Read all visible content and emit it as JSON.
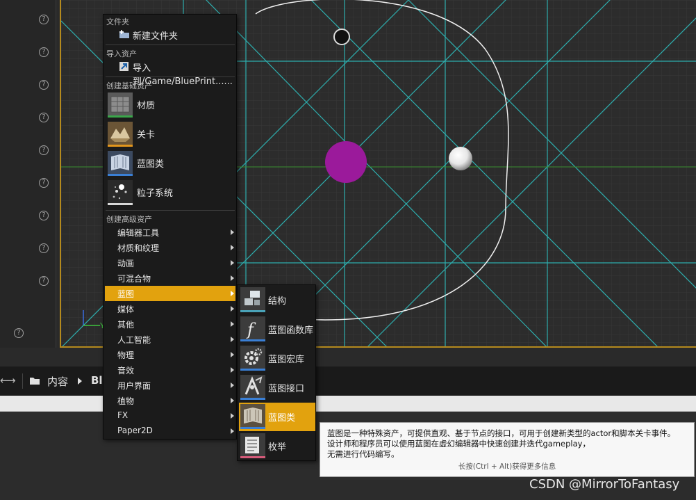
{
  "viewport": {
    "axis_label_y": "Y"
  },
  "help_icon_glyph": "?",
  "content_browser": {
    "back_glyph": "←",
    "forward_glyph": "→",
    "crumb_root": "内容",
    "crumb_next": "Blu"
  },
  "context_menu": {
    "section_folder": "文件夹",
    "new_folder": "新建文件夹",
    "section_import": "导入资产",
    "import_to": "导入到/Game/BluePrint......",
    "section_basic": "创建基础资产",
    "basic_items": [
      {
        "label": "材质",
        "icon": "material-icon",
        "bar_color": "#3aa64a"
      },
      {
        "label": "关卡",
        "icon": "level-icon",
        "bar_color": "#e2961c"
      },
      {
        "label": "蓝图类",
        "icon": "blueprint-class-icon",
        "bar_color": "#3a7fd5"
      },
      {
        "label": "粒子系统",
        "icon": "particle-system-icon",
        "bar_color": "#d8d8d8"
      }
    ],
    "section_advanced": "创建高级资产",
    "advanced_items": [
      {
        "label": "编辑器工具"
      },
      {
        "label": "材质和纹理"
      },
      {
        "label": "动画"
      },
      {
        "label": "可混合物"
      },
      {
        "label": "蓝图"
      },
      {
        "label": "媒体"
      },
      {
        "label": "其他"
      },
      {
        "label": "人工智能"
      },
      {
        "label": "物理"
      },
      {
        "label": "音效"
      },
      {
        "label": "用户界面"
      },
      {
        "label": "植物"
      },
      {
        "label": "FX"
      },
      {
        "label": "Paper2D"
      }
    ],
    "active_index": 4
  },
  "submenu": {
    "items": [
      {
        "label": "结构",
        "icon": "struct-icon",
        "bar_color": "#4aa3b8"
      },
      {
        "label": "蓝图函数库",
        "icon": "function-library-icon",
        "bar_color": "#3a7fd5"
      },
      {
        "label": "蓝图宏库",
        "icon": "macro-library-icon",
        "bar_color": "#3a7fd5"
      },
      {
        "label": "蓝图接口",
        "icon": "interface-icon",
        "bar_color": "#3a7fd5"
      },
      {
        "label": "蓝图类",
        "icon": "blueprint-class-icon",
        "bar_color": "#3a7fd5"
      },
      {
        "label": "枚举",
        "icon": "enum-icon",
        "bar_color": "#d65b7a"
      }
    ],
    "active_index": 4
  },
  "tooltip": {
    "description": "蓝图是一种特殊资产，可提供直观、基于节点的接口，可用于创建新类型的actor和脚本关卡事件。\n设计师和程序员可以使用蓝图在虚幻编辑器中快速创建并迭代gameplay，\n无需进行代码编写。",
    "hint": "长按(Ctrl + Alt)获得更多信息"
  },
  "watermark": "CSDN @MirrorToFantasy",
  "colors": {
    "accent": "#e2a20e",
    "grid": "#2ec4c4",
    "sphere_purple": "#9b1a9b"
  }
}
